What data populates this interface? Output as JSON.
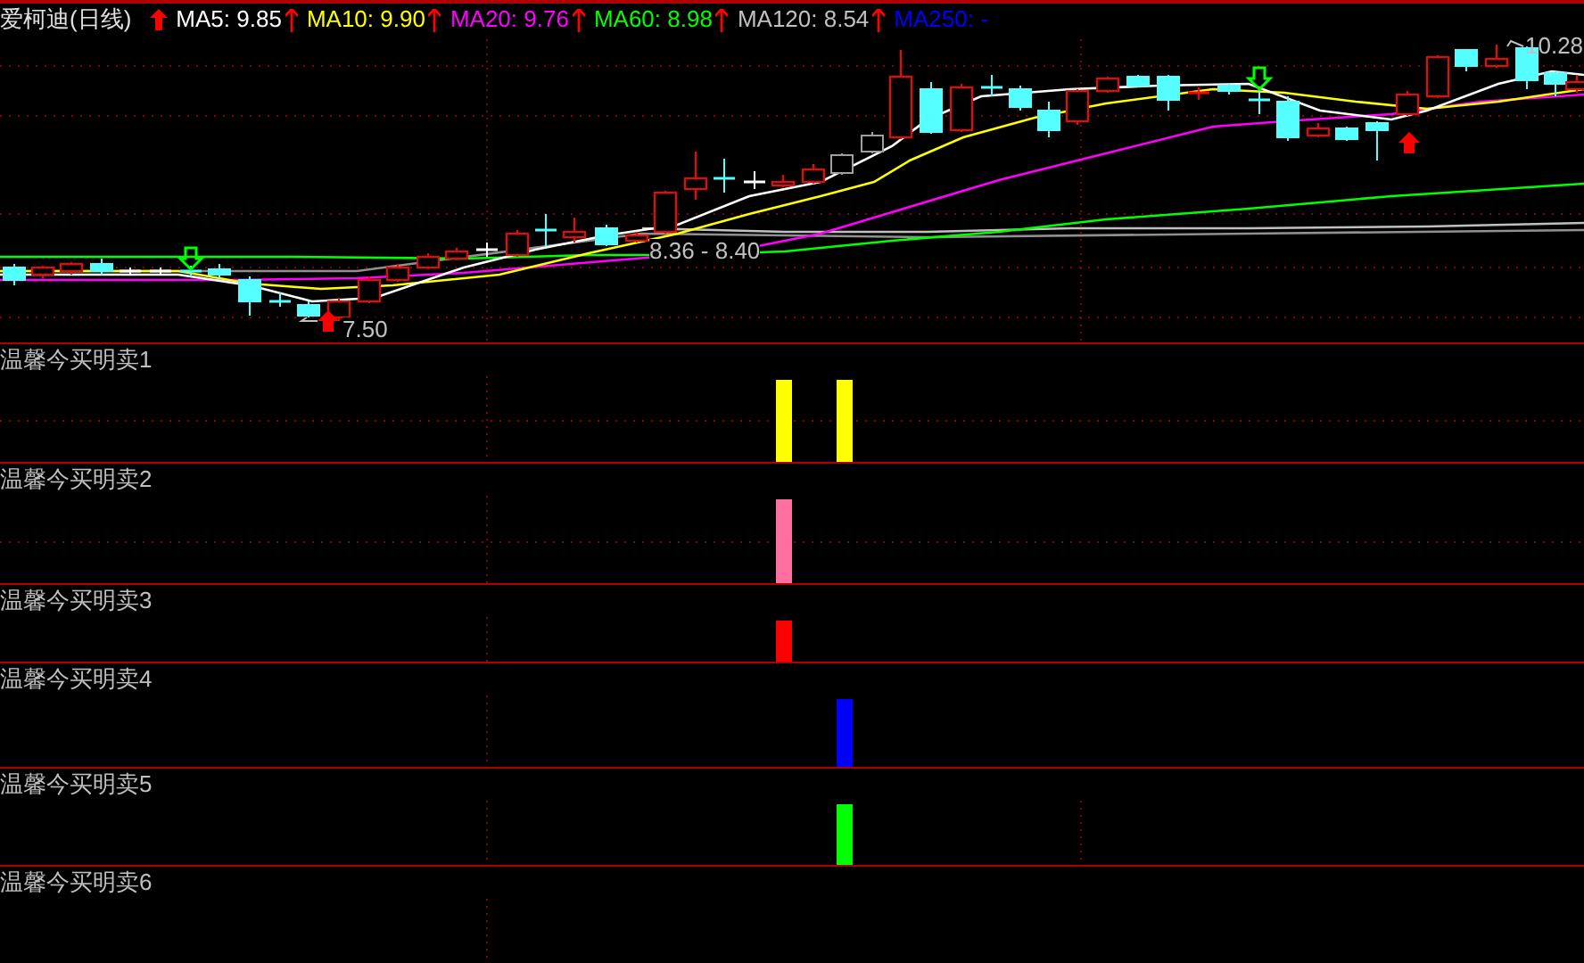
{
  "main_chart": {
    "title": "爱柯迪(日线)",
    "moving_averages": [
      {
        "label": "MA5: 9.85",
        "color": "#ffffff",
        "rising": true
      },
      {
        "label": "MA10: 9.90",
        "color": "#ffff00",
        "rising": true
      },
      {
        "label": "MA20: 9.76",
        "color": "#ff00ff",
        "rising": true
      },
      {
        "label": "MA60: 8.98",
        "color": "#00ff00",
        "rising": true
      },
      {
        "label": "MA120: 8.54",
        "color": "#c0c0c0",
        "rising": true
      },
      {
        "label": "MA250: -",
        "color": "#0000ff",
        "rising": false
      }
    ],
    "high_label": "10.28",
    "range_label": "8.36 - 8.40",
    "low_label": "7.50"
  },
  "indicator_panels": [
    {
      "label": "温馨今买明卖1"
    },
    {
      "label": "温馨今买明卖2"
    },
    {
      "label": "温馨今买明卖3"
    },
    {
      "label": "温馨今买明卖4"
    },
    {
      "label": "温馨今买明卖5"
    },
    {
      "label": "温馨今买明卖6"
    }
  ]
}
